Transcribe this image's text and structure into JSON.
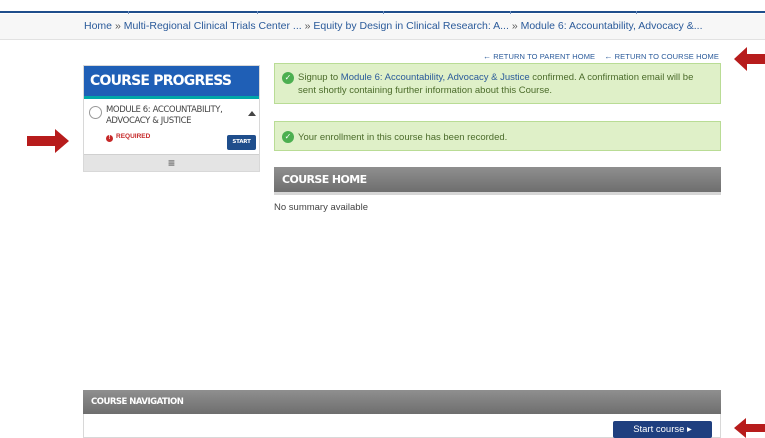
{
  "breadcrumb": {
    "items": [
      "Home",
      "Multi-Regional Clinical Trials Center ...",
      "Equity by Design in Clinical Research: A...",
      "Module 6: Accountability, Advocacy &..."
    ],
    "separator": "»"
  },
  "return_links": {
    "parent": "RETURN TO PARENT HOME",
    "course": "RETURN TO COURSE HOME"
  },
  "progress": {
    "title": "COURSE PROGRESS",
    "item_title": "MODULE 6: ACCOUNTABILITY, ADVOCACY & JUSTICE",
    "required_label": "REQUIRED",
    "start_label": "START",
    "menu_glyph": "≡"
  },
  "alerts": {
    "signup_prefix": "Signup to ",
    "signup_link": "Module 6: Accountability, Advocacy & Justice",
    "signup_suffix": " confirmed. A confirmation email will be sent shortly containing further information about this Course.",
    "enrollment": "Your enrollment in this course has been recorded."
  },
  "course_home": {
    "title": "COURSE HOME",
    "summary": "No summary available"
  },
  "course_navigation": {
    "title": "COURSE NAVIGATION",
    "start_button": "Start course ▸"
  },
  "colors": {
    "brand_blue": "#1f5fb6",
    "accent_teal": "#00a8a8",
    "success_bg": "#dff0c8",
    "annotation_red": "#b71c1c"
  }
}
